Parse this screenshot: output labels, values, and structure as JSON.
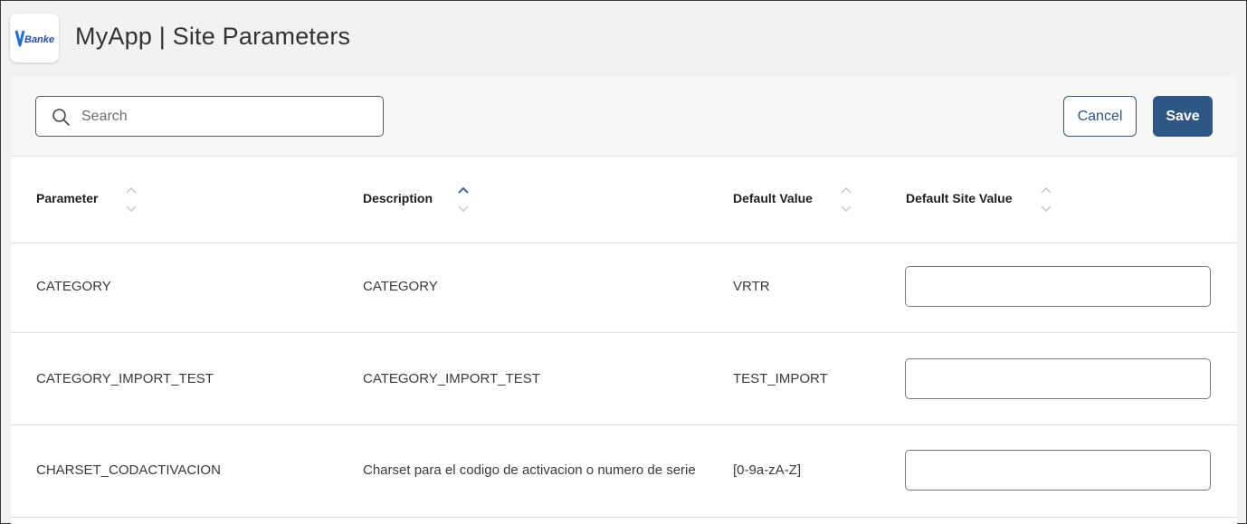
{
  "header": {
    "logo_text": "Banked",
    "title": "MyApp | Site Parameters"
  },
  "toolbar": {
    "search": {
      "placeholder": "Search",
      "value": ""
    },
    "cancel_label": "Cancel",
    "save_label": "Save"
  },
  "table": {
    "columns": [
      {
        "label": "Parameter",
        "sort": "none"
      },
      {
        "label": "Description",
        "sort": "ascending"
      },
      {
        "label": "Default Value",
        "sort": "none"
      },
      {
        "label": "Default Site Value",
        "sort": "none"
      }
    ],
    "rows": [
      {
        "parameter": "CATEGORY",
        "description": "CATEGORY",
        "default_value": "VRTR",
        "site_value": ""
      },
      {
        "parameter": "CATEGORY_IMPORT_TEST",
        "description": "CATEGORY_IMPORT_TEST",
        "default_value": "TEST_IMPORT",
        "site_value": ""
      },
      {
        "parameter": "CHARSET_CODACTIVACION",
        "description": "Charset para el codigo de activacion o numero de serie",
        "default_value": "[0-9a-zA-Z]",
        "site_value": ""
      }
    ]
  },
  "colors": {
    "primary": "#2f5685",
    "background": "#f2f2f2",
    "panel": "#ffffff",
    "sort_active": "#2f5685",
    "sort_inactive": "#c4c4c4"
  }
}
